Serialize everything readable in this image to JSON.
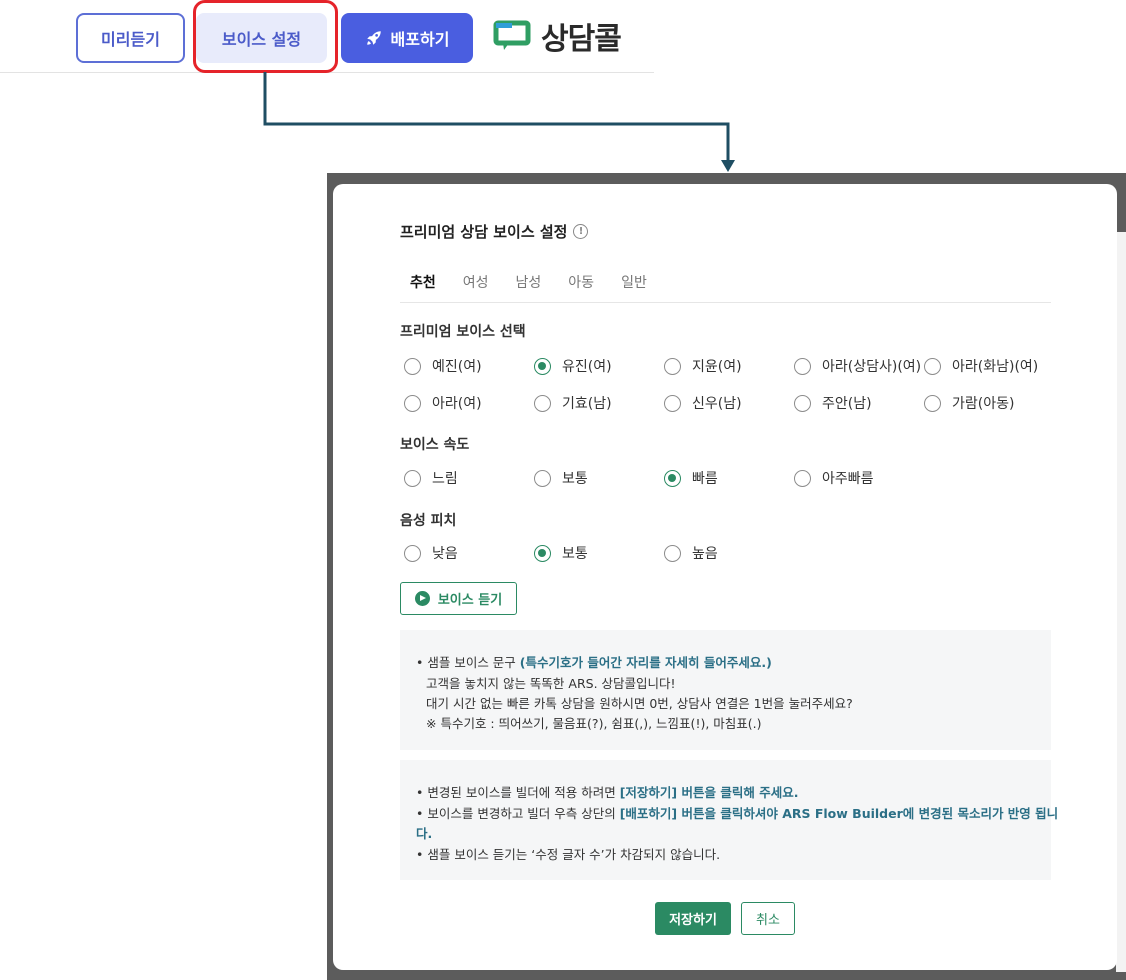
{
  "toolbar": {
    "preview_label": "미리듣기",
    "voice_settings_label": "보이스 설정",
    "deploy_label": "배포하기",
    "brand": "상담콜"
  },
  "modal": {
    "title": "프리미엄 상담 보이스 설정",
    "info_icon_glyph": "!",
    "tabs": [
      {
        "label": "추천",
        "active": true
      },
      {
        "label": "여성",
        "active": false
      },
      {
        "label": "남성",
        "active": false
      },
      {
        "label": "아동",
        "active": false
      },
      {
        "label": "일반",
        "active": false
      }
    ],
    "voice_select": {
      "label": "프리미엄 보이스 선택",
      "options": [
        "예진(여)",
        "유진(여)",
        "지윤(여)",
        "아라(상담사)(여)",
        "아라(화남)(여)",
        "아라(여)",
        "기효(남)",
        "신우(남)",
        "주안(남)",
        "가람(아동)"
      ],
      "selected": "유진(여)"
    },
    "speed": {
      "label": "보이스 속도",
      "options": [
        "느림",
        "보통",
        "빠름",
        "아주빠름"
      ],
      "selected": "빠름"
    },
    "pitch": {
      "label": "음성 피치",
      "options": [
        "낮음",
        "보통",
        "높음"
      ],
      "selected": "보통"
    },
    "listen_button": "보이스 듣기",
    "sample": {
      "prefix": "• 샘플 보이스 문구 ",
      "highlight": "(특수기호가 들어간 자리를 자세히 들어주세요.)",
      "line1": "고객을 놓치지 않는 똑똑한 ARS. 상담콜입니다!",
      "line2": "대기 시간 없는 빠른 카톡 상담을 원하시면 0번, 상담사 연결은 1번을 눌러주세요?",
      "line3": "※ 특수기호 : 띄어쓰기, 물음표(?), 쉼표(,), 느낌표(!), 마침표(.)"
    },
    "notes": {
      "n1_prefix": "• 변경된 보이스를 빌더에 적용 하려면 ",
      "n1_highlight": "[저장하기] 버튼을 클릭해 주세요.",
      "n2_prefix": "• 보이스를 변경하고 빌더 우측 상단의 ",
      "n2_highlight": "[배포하기] 버튼을 클릭하셔야 ARS Flow Builder에 변경된 목소리가 반영 됩니",
      "n2_tail": "다.",
      "n3": "• 샘플 보이스 듣기는 ‘수정 글자 수’가 차감되지 않습니다."
    },
    "save_button": "저장하기",
    "cancel_button": "취소"
  },
  "colors": {
    "accent_green": "#2b8a63",
    "primary_blue": "#4a5ee0",
    "highlight_red": "#e5232a",
    "note_link": "#2b6f86"
  }
}
